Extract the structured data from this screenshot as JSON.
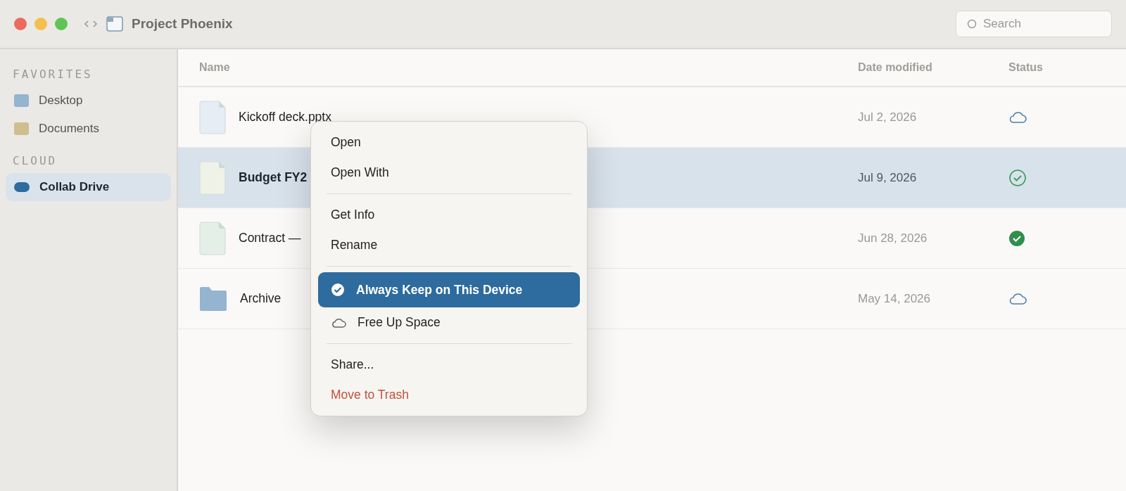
{
  "window": {
    "title": "Project Phoenix"
  },
  "search": {
    "placeholder": "Search"
  },
  "sidebar": {
    "sections": [
      {
        "title": "FAVORITES",
        "items": [
          {
            "label": "Desktop",
            "color": "#94b4cf",
            "kind": "folder",
            "selected": false
          },
          {
            "label": "Documents",
            "color": "#cfbf8e",
            "kind": "folder",
            "selected": false
          }
        ]
      },
      {
        "title": "CLOUD",
        "items": [
          {
            "label": "Collab Drive",
            "color": "#2e6b9e",
            "kind": "drive",
            "selected": true
          }
        ]
      }
    ]
  },
  "table": {
    "columns": [
      "Name",
      "Date modified",
      "Status"
    ],
    "rows": [
      {
        "name": "Kickoff deck.pptx",
        "kind": "file",
        "color": "#e6edf5",
        "date": "Jul 2, 2026",
        "status": {
          "kind": "cloud"
        },
        "selected": false
      },
      {
        "name": "Budget FY2",
        "kind": "file",
        "color": "#eff2e6",
        "date": "Jul 9, 2026",
        "status": {
          "kind": "synced"
        },
        "selected": true
      },
      {
        "name": "Contract —",
        "kind": "file",
        "color": "#e4efe7",
        "date": "Jun 28, 2026",
        "status": {
          "kind": "pinned"
        },
        "selected": false
      },
      {
        "name": "Archive",
        "kind": "folder",
        "color": "#94b4cf",
        "date": "May 14, 2026",
        "status": {
          "kind": "cloud"
        },
        "selected": false
      }
    ]
  },
  "context_menu": {
    "groups": [
      [
        {
          "label": "Open",
          "kind": "plain",
          "selected": false
        },
        {
          "label": "Open With",
          "kind": "plain",
          "selected": false
        }
      ],
      [
        {
          "label": "Get Info",
          "kind": "plain",
          "selected": false
        },
        {
          "label": "Rename",
          "kind": "plain",
          "selected": false
        }
      ],
      [
        {
          "label": "Always Keep on This Device",
          "kind": "check",
          "selected": true
        },
        {
          "label": "Free Up Space",
          "kind": "cloud",
          "selected": false
        }
      ],
      [
        {
          "label": "Share...",
          "kind": "plain",
          "selected": false
        },
        {
          "label": "Move to Trash",
          "kind": "danger",
          "selected": false
        }
      ]
    ]
  }
}
